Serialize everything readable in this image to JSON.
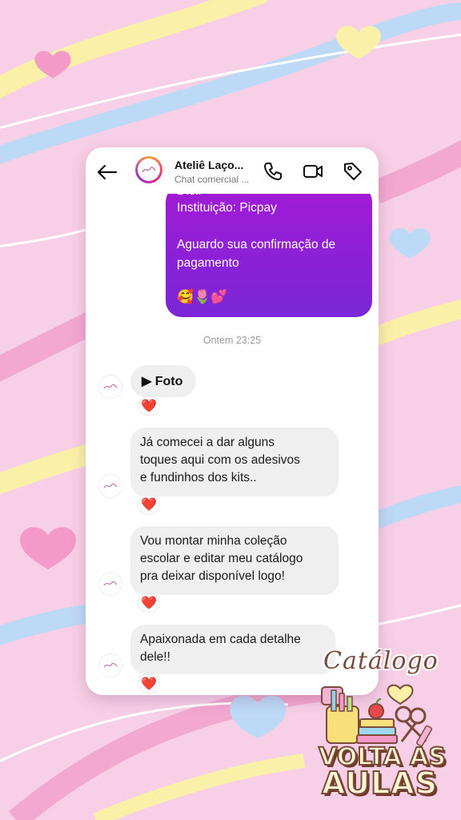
{
  "chat": {
    "title": "Ateliê Laço...",
    "subtitle": "Chat comercial ...",
    "outgoing_lines": [
      "Dieli",
      "Instituição: Picpay",
      "Aguardo sua confirmação de",
      "pagamento",
      "🥰🌷💕"
    ],
    "timestamp": "Ontem 23:25",
    "foto_label": "▶ Foto",
    "messages": [
      [
        "Já comecei a dar alguns",
        "toques aqui com os adesivos",
        "e fundinhos dos kits.."
      ],
      [
        "Vou montar minha coleção",
        "escolar e editar meu catálogo",
        "pra deixar disponível logo!"
      ],
      [
        "Apaixonada em cada detalhe",
        "dele!!"
      ]
    ],
    "reaction_emoji": "❤️"
  },
  "decoration": {
    "title": "Catálogo",
    "line1": "VOLTA AS",
    "line2": "AULAS"
  },
  "colors": {
    "background": "#f7cfe6",
    "outgoing_bubble_top": "#a21ad6",
    "outgoing_bubble_bottom": "#7a26d8",
    "incoming_bubble": "#efefef"
  },
  "icons": {
    "back": "arrow-left-icon",
    "call": "phone-icon",
    "video": "video-camera-icon",
    "tag": "tag-icon"
  }
}
